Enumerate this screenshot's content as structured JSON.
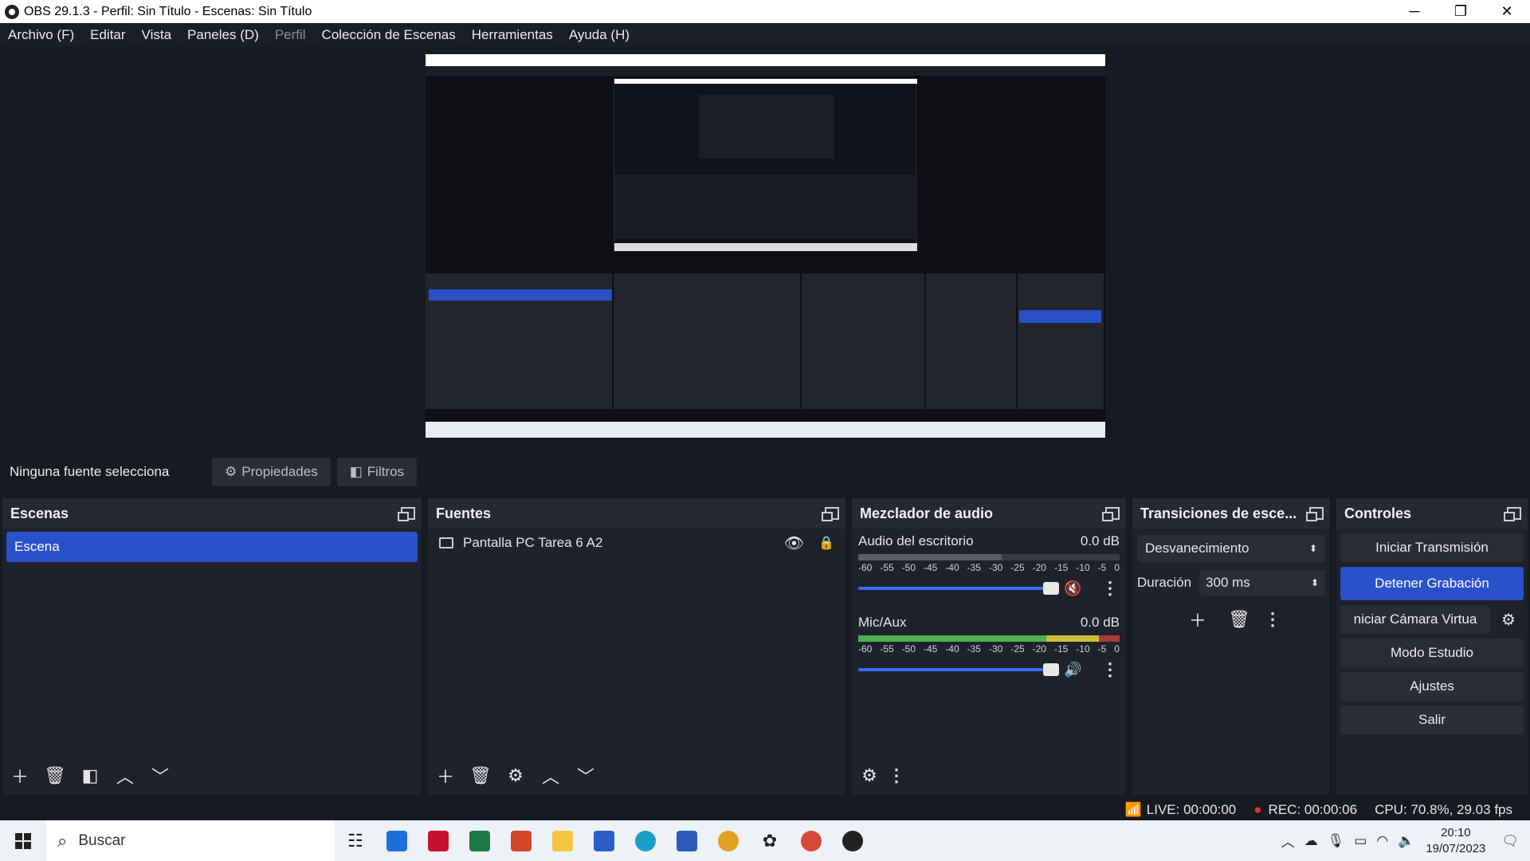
{
  "window": {
    "title": "OBS 29.1.3 - Perfil: Sin Título - Escenas: Sin Título",
    "min": "─",
    "max": "❐",
    "close": "✕"
  },
  "menu": [
    "Archivo (F)",
    "Editar",
    "Vista",
    "Paneles (D)",
    "Perfil",
    "Colección de Escenas",
    "Herramientas",
    "Ayuda (H)"
  ],
  "source_bar": {
    "label": "Ninguna fuente selecciona",
    "properties": "Propiedades",
    "filters": "Filtros"
  },
  "scenes": {
    "title": "Escenas",
    "items": [
      "Escena"
    ]
  },
  "sources": {
    "title": "Fuentes",
    "items": [
      {
        "name": "Pantalla PC Tarea 6 A2"
      }
    ]
  },
  "mixer": {
    "title": "Mezclador de audio",
    "scale": [
      "-60",
      "-55",
      "-50",
      "-45",
      "-40",
      "-35",
      "-30",
      "-25",
      "-20",
      "-15",
      "-10",
      "-5",
      "0"
    ],
    "channels": [
      {
        "name": "Audio del escritorio",
        "db": "0.0 dB",
        "muted": true,
        "volume": 0.95
      },
      {
        "name": "Mic/Aux",
        "db": "0.0 dB",
        "muted": false,
        "volume": 0.95
      }
    ]
  },
  "transitions": {
    "title": "Transiciones de esce...",
    "selected": "Desvanecimiento",
    "duration_label": "Duración",
    "duration": "300 ms"
  },
  "controls": {
    "title": "Controles",
    "start_stream": "Iniciar Transmisión",
    "stop_record": "Detener Grabación",
    "virtual_cam": "niciar Cámara Virtua",
    "studio": "Modo Estudio",
    "settings": "Ajustes",
    "exit": "Salir"
  },
  "status": {
    "live": "LIVE: 00:00:00",
    "rec": "REC: 00:00:06",
    "cpu": "CPU: 70.8%, 29.03 fps"
  },
  "taskbar": {
    "search": "Buscar",
    "time": "20:10",
    "date": "19/07/2023"
  },
  "colors": {
    "accent": "#2951c9",
    "bg": "#181a21",
    "dock": "#1f222b",
    "rec": "#e03030"
  }
}
